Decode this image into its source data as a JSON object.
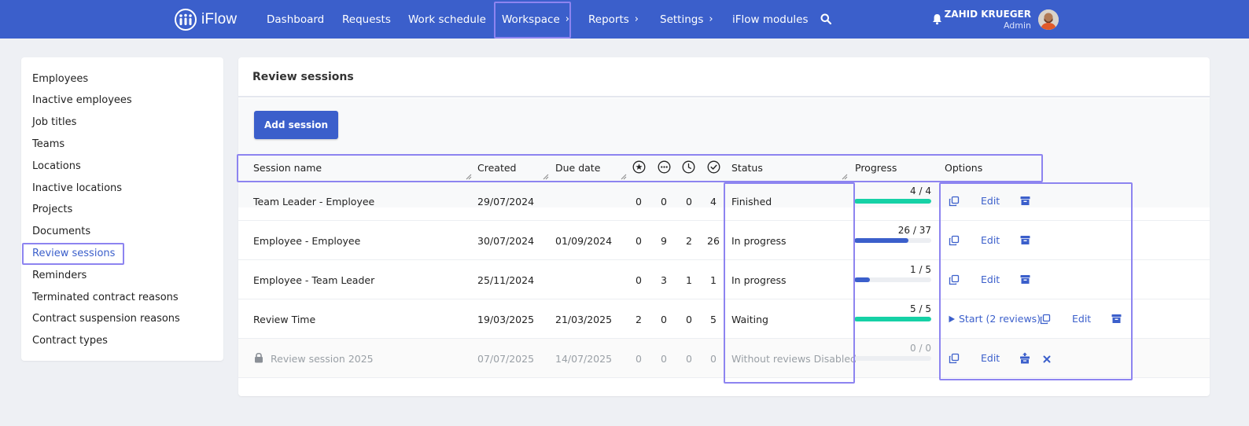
{
  "app": {
    "name": "iFlow"
  },
  "nav": {
    "items": [
      {
        "label": "Dashboard",
        "has_chevron": false
      },
      {
        "label": "Requests",
        "has_chevron": false
      },
      {
        "label": "Work schedule",
        "has_chevron": false
      },
      {
        "label": "Workspace",
        "has_chevron": true
      },
      {
        "label": "Reports",
        "has_chevron": true
      },
      {
        "label": "Settings",
        "has_chevron": true
      },
      {
        "label": "iFlow modules",
        "has_chevron": false
      }
    ],
    "active": "Workspace"
  },
  "user": {
    "name": "ZAHID KRUEGER",
    "role": "Admin"
  },
  "sidebar": {
    "items": [
      {
        "label": "Employees"
      },
      {
        "label": "Inactive employees"
      },
      {
        "label": "Job titles"
      },
      {
        "label": "Teams"
      },
      {
        "label": "Locations"
      },
      {
        "label": "Inactive locations"
      },
      {
        "label": "Projects"
      },
      {
        "label": "Documents"
      },
      {
        "label": "Review sessions"
      },
      {
        "label": "Reminders"
      },
      {
        "label": "Terminated contract reasons"
      },
      {
        "label": "Contract suspension reasons"
      },
      {
        "label": "Contract types"
      }
    ],
    "active": "Review sessions"
  },
  "page": {
    "title": "Review sessions",
    "add_button": "Add session"
  },
  "table": {
    "columns": {
      "session_name": "Session name",
      "created": "Created",
      "due_date": "Due date",
      "status": "Status",
      "progress": "Progress",
      "options": "Options"
    },
    "count_icons": [
      "star-circle-icon",
      "dots-circle-icon",
      "clock-icon",
      "check-circle-icon"
    ],
    "rows": [
      {
        "name": "Team Leader - Employee",
        "created": "29/07/2024",
        "due": "",
        "c1": "0",
        "c2": "0",
        "c3": "0",
        "c4": "4",
        "status": "Finished",
        "progress_label": "4 / 4",
        "progress": 1.0,
        "bar_color": "#16d1a6",
        "start_label": "",
        "locked": false
      },
      {
        "name": "Employee - Employee",
        "created": "30/07/2024",
        "due": "01/09/2024",
        "c1": "0",
        "c2": "9",
        "c3": "2",
        "c4": "26",
        "status": "In progress",
        "progress_label": "26 / 37",
        "progress": 0.703,
        "bar_color": "#3b5fcb",
        "start_label": "",
        "locked": false
      },
      {
        "name": "Employee - Team Leader",
        "created": "25/11/2024",
        "due": "",
        "c1": "0",
        "c2": "3",
        "c3": "1",
        "c4": "1",
        "status": "In progress",
        "progress_label": "1 / 5",
        "progress": 0.2,
        "bar_color": "#3b5fcb",
        "start_label": "",
        "locked": false
      },
      {
        "name": "Review Time",
        "created": "19/03/2025",
        "due": "21/03/2025",
        "c1": "2",
        "c2": "0",
        "c3": "0",
        "c4": "5",
        "status": "Waiting",
        "progress_label": "5 / 5",
        "progress": 1.0,
        "bar_color": "#16d1a6",
        "start_label": "Start",
        "start_count": "(2 reviews)",
        "locked": false
      },
      {
        "name": "Review session 2025",
        "created": "07/07/2025",
        "due": "14/07/2025",
        "c1": "0",
        "c2": "0",
        "c3": "0",
        "c4": "0",
        "status": "Without reviews Disabled",
        "progress_label": "0 / 0",
        "progress": 0,
        "bar_color": "#3b5fcb",
        "start_label": "",
        "locked": true
      }
    ],
    "edit_label": "Edit"
  },
  "colors": {
    "brand": "#3b5fcb",
    "highlight": "#8d84f0",
    "success": "#16d1a6"
  }
}
